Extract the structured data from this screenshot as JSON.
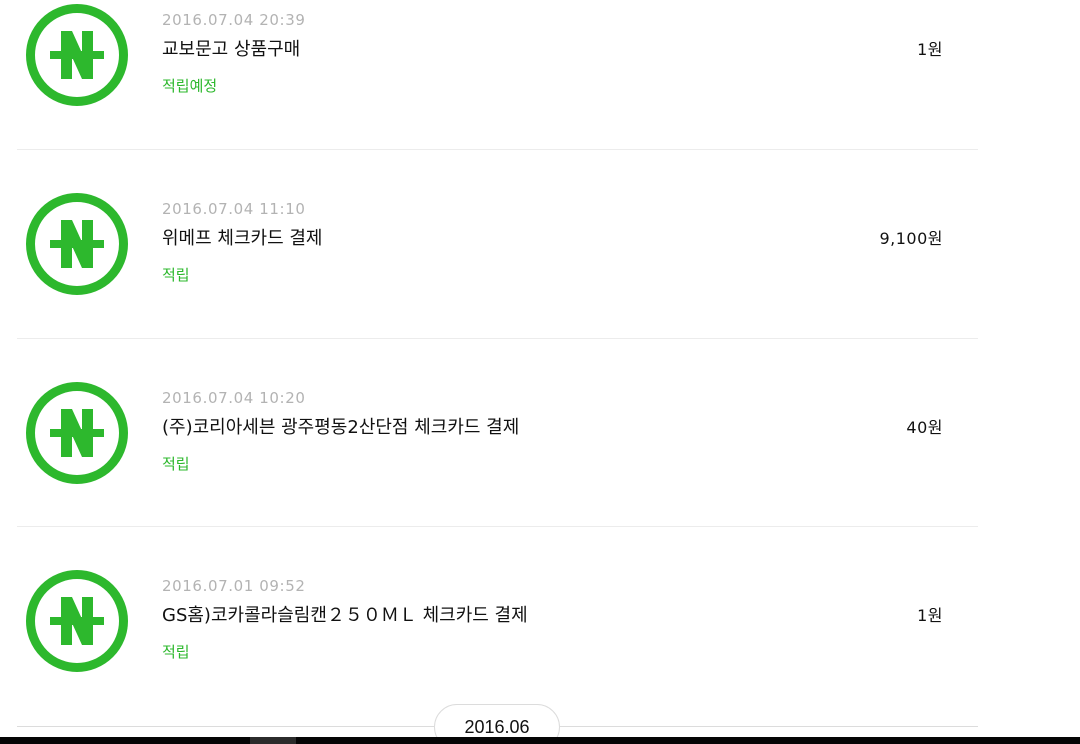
{
  "transactions": [
    {
      "date": "2016.07.04 20:39",
      "title": "교보문고 상품구매",
      "status": "적립예정",
      "amount": "1원"
    },
    {
      "date": "2016.07.04 11:10",
      "title": "위메프 체크카드 결제",
      "status": "적립",
      "amount": "9,100원"
    },
    {
      "date": "2016.07.04 10:20",
      "title": "(주)코리아세븐 광주평동2산단점 체크카드 결제",
      "status": "적립",
      "amount": "40원"
    },
    {
      "date": "2016.07.01 09:52",
      "title": "GS홈)코카콜라슬림캔２５０ＭＬ 체크카드 결제",
      "status": "적립",
      "amount": "1원"
    }
  ],
  "month_header": "2016.06",
  "icons": {
    "logo": "naver-pay-n-icon"
  },
  "colors": {
    "accent_green": "#2db82d",
    "date_gray": "#b3b3b3",
    "divider": "#ececec"
  }
}
